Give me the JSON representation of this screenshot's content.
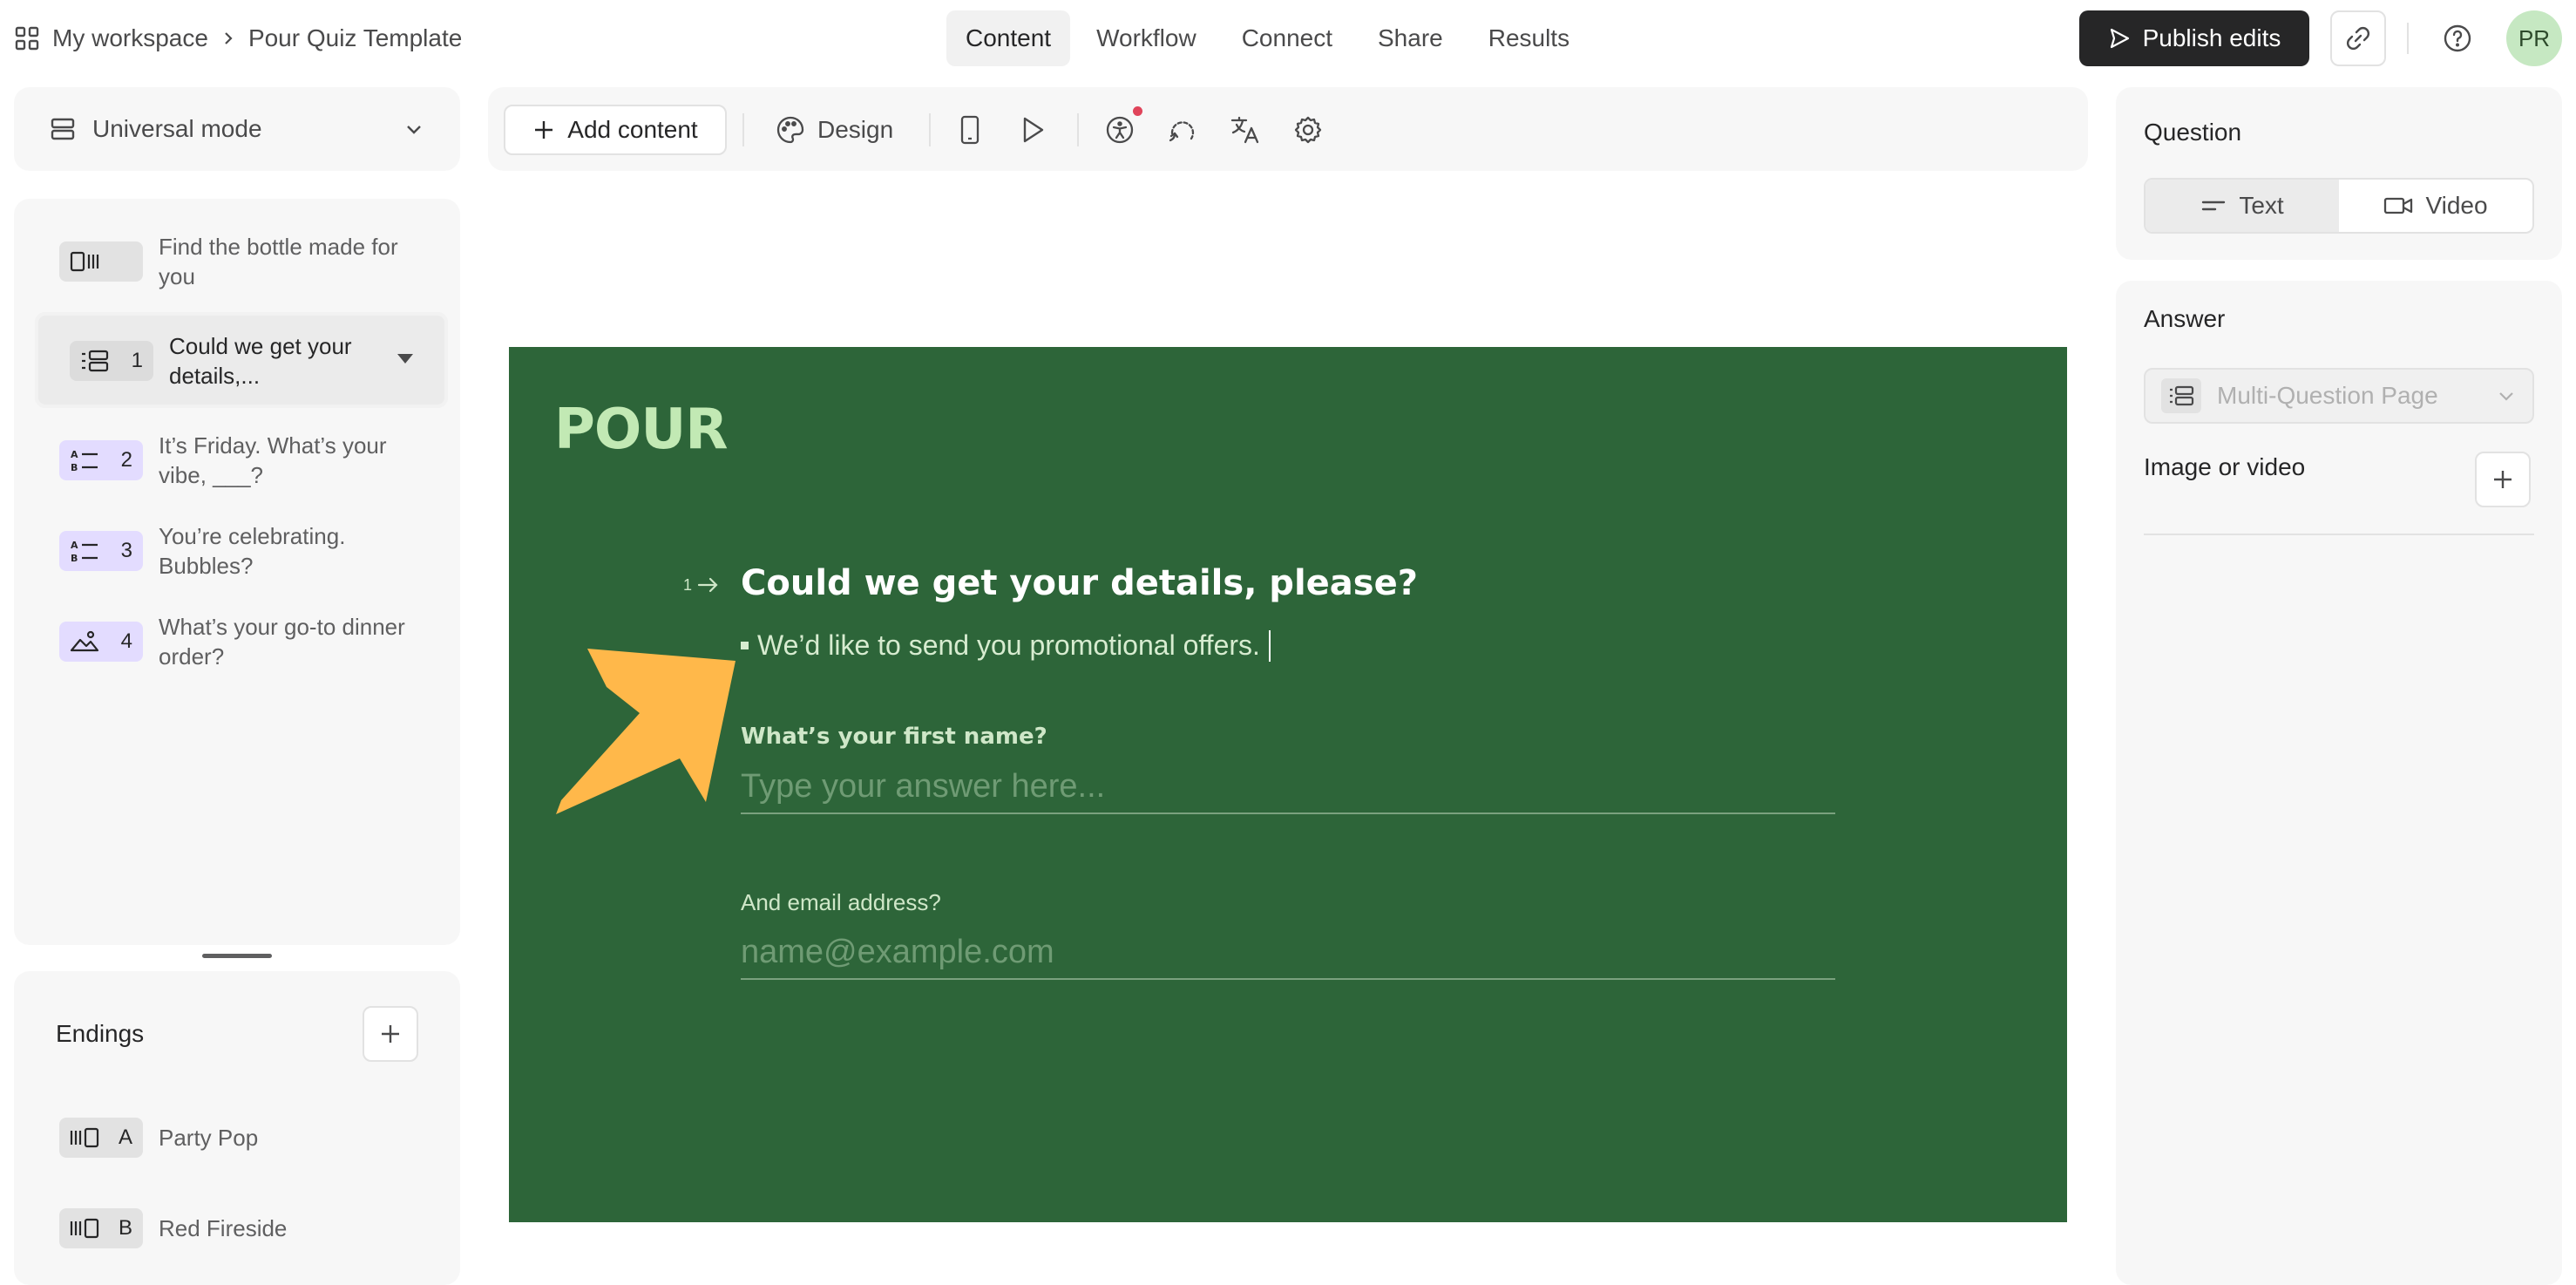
{
  "breadcrumb": {
    "workspace": "My workspace",
    "form_title": "Pour Quiz Template"
  },
  "nav": {
    "tabs": [
      "Content",
      "Workflow",
      "Connect",
      "Share",
      "Results"
    ],
    "active": "Content"
  },
  "header": {
    "publish_label": "Publish edits",
    "avatar_initials": "PR"
  },
  "sidebar": {
    "mode_label": "Universal mode",
    "questions": [
      {
        "number": "",
        "text": "Find the bottle made for you",
        "icon": "welcome-screen-icon",
        "selected": false
      },
      {
        "number": "1",
        "text": "Could we get your details,...",
        "icon": "multi-question-icon",
        "selected": true
      },
      {
        "number": "2",
        "text": "It’s Friday. What’s your vibe, ___?",
        "icon": "multiple-choice-icon",
        "selected": false
      },
      {
        "number": "3",
        "text": "You’re celebrating. Bubbles?",
        "icon": "multiple-choice-icon",
        "selected": false
      },
      {
        "number": "4",
        "text": "What’s your go-to dinner order?",
        "icon": "picture-choice-icon",
        "selected": false
      }
    ],
    "endings_title": "Endings",
    "endings": [
      {
        "letter": "A",
        "text": "Party Pop",
        "icon": "ending-screen-icon"
      },
      {
        "letter": "B",
        "text": "Red Fireside",
        "icon": "ending-screen-icon"
      }
    ]
  },
  "toolbar": {
    "add_content_label": "Add content",
    "design_label": "Design"
  },
  "canvas": {
    "logo": "POUR",
    "question_number": "1",
    "question_title": "Could we get your details, please?",
    "question_description": "We’d like to send you promotional offers.",
    "field1_label": "What’s your first name?",
    "field1_placeholder": "Type your answer here...",
    "field2_label": "And email address?",
    "field2_placeholder": "name@example.com",
    "background_color": "#2d6539",
    "arrow_color": "#ffb84a"
  },
  "right_panel": {
    "question_heading": "Question",
    "type_options": [
      "Text",
      "Video"
    ],
    "type_selected": "Text",
    "answer_heading": "Answer",
    "answer_type": "Multi-Question Page",
    "media_label": "Image or video"
  }
}
